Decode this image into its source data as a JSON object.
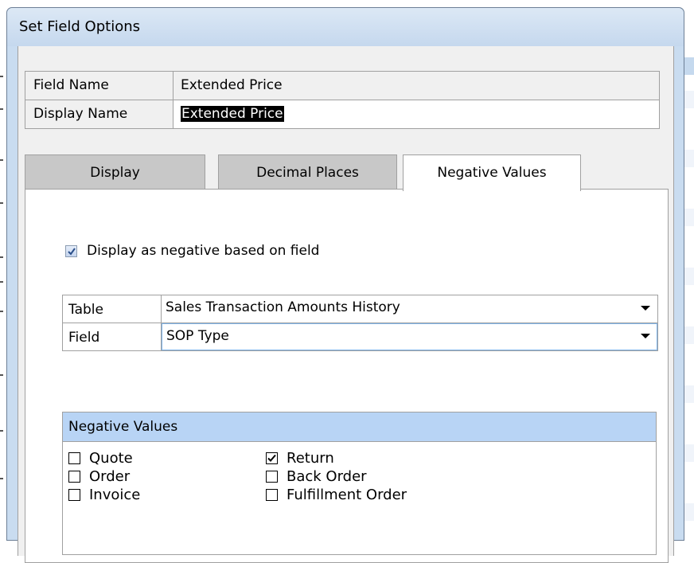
{
  "dialog": {
    "title": "Set Field Options"
  },
  "names": {
    "field_name_label": "Field Name",
    "field_name_value": "Extended Price",
    "display_name_label": "Display Name",
    "display_name_value": "Extended Price"
  },
  "tabs": [
    {
      "label": "Display",
      "active": false
    },
    {
      "label": "Decimal Places",
      "active": false
    },
    {
      "label": "Negative Values",
      "active": true
    }
  ],
  "negative_tab": {
    "display_as_negative": {
      "label": "Display as negative based on field",
      "checked": true
    },
    "table": {
      "label": "Table",
      "value": "Sales Transaction Amounts History"
    },
    "field": {
      "label": "Field",
      "value": "SOP Type"
    },
    "group": {
      "title": "Negative Values",
      "items": [
        {
          "label": "Quote",
          "checked": false
        },
        {
          "label": "Order",
          "checked": false
        },
        {
          "label": "Invoice",
          "checked": false
        },
        {
          "label": "Return",
          "checked": true
        },
        {
          "label": "Back Order",
          "checked": false
        },
        {
          "label": "Fulfillment Order",
          "checked": false
        }
      ]
    }
  },
  "colors": {
    "title_bar": "#c5d8ee",
    "group_header": "#b8d4f5",
    "inactive_tab": "#c8c8c8",
    "focus_border": "#7eb4ea"
  }
}
